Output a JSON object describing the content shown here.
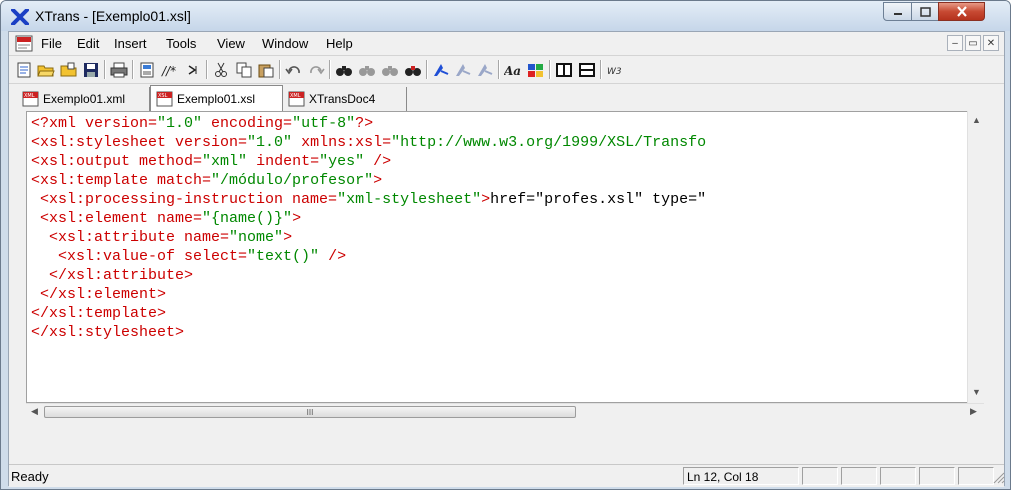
{
  "window": {
    "title": "XTrans - [Exemplo01.xsl]"
  },
  "menu": {
    "items": [
      "File",
      "Edit",
      "Insert",
      "Tools",
      "View",
      "Window",
      "Help"
    ]
  },
  "toolbar": {
    "buttons": [
      "new-icon",
      "open-icon",
      "open-folder-icon",
      "save-icon",
      "print-icon",
      "properties-icon",
      "comment-icon",
      "indent-icon",
      "cut-icon",
      "copy-icon",
      "paste-icon",
      "undo-icon",
      "redo-icon",
      "find-icon",
      "find-next-icon",
      "find-prev-icon",
      "replace-icon",
      "transform-icon",
      "transform-all-icon",
      "transform-options-icon",
      "font-icon",
      "color-icon",
      "split-vertical-icon",
      "split-horizontal-icon",
      "w3-icon"
    ],
    "w3_label": "W3"
  },
  "tabs": [
    {
      "label": "Exemplo01.xml",
      "icon": "xml-file-icon",
      "icon_text": "XML",
      "active": false
    },
    {
      "label": "Exemplo01.xsl",
      "icon": "xsl-file-icon",
      "icon_text": "XSL",
      "active": true
    },
    {
      "label": "XTransDoc4",
      "icon": "xml-file-icon",
      "icon_text": "XML",
      "active": false
    }
  ],
  "editor": {
    "lines": [
      [
        [
          "tag",
          "<?xml "
        ],
        [
          "attr",
          "version="
        ],
        [
          "val",
          "\"1.0\""
        ],
        [
          "attr",
          " encoding="
        ],
        [
          "val",
          "\"utf-8\""
        ],
        [
          "tag",
          "?>"
        ]
      ],
      [
        [
          "tag",
          "<xsl:stylesheet "
        ],
        [
          "attr",
          "version="
        ],
        [
          "val",
          "\"1.0\""
        ],
        [
          "attr",
          " xmlns:xsl="
        ],
        [
          "val",
          "\"http://www.w3.org/1999/XSL/Transfo"
        ]
      ],
      [
        [
          "tag",
          "<xsl:output "
        ],
        [
          "attr",
          "method="
        ],
        [
          "val",
          "\"xml\""
        ],
        [
          "attr",
          " indent="
        ],
        [
          "val",
          "\"yes\""
        ],
        [
          "tag",
          " />"
        ]
      ],
      [
        [
          "tag",
          "<xsl:template "
        ],
        [
          "attr",
          "match="
        ],
        [
          "val",
          "\"/módulo/profesor\""
        ],
        [
          "tag",
          ">"
        ]
      ],
      [
        [
          "tag",
          " <xsl:processing-instruction "
        ],
        [
          "attr",
          "name="
        ],
        [
          "val",
          "\"xml-stylesheet\""
        ],
        [
          "tag",
          ">"
        ],
        [
          "text",
          "href=\"profes.xsl\" type=\""
        ]
      ],
      [
        [
          "tag",
          " <xsl:element "
        ],
        [
          "attr",
          "name="
        ],
        [
          "val",
          "\"{name()}\""
        ],
        [
          "tag",
          ">"
        ]
      ],
      [
        [
          "tag",
          "  <xsl:attribute "
        ],
        [
          "attr",
          "name="
        ],
        [
          "val",
          "\"nome\""
        ],
        [
          "tag",
          ">"
        ]
      ],
      [
        [
          "tag",
          "   <xsl:value-of "
        ],
        [
          "attr",
          "select="
        ],
        [
          "val",
          "\"text()\""
        ],
        [
          "tag",
          " />"
        ]
      ],
      [
        [
          "tag",
          "  </xsl:attribute>"
        ]
      ],
      [
        [
          "tag",
          " </xsl:element>"
        ]
      ],
      [
        [
          "tag",
          "</xsl:template>"
        ]
      ],
      [
        [
          "tag",
          "</xsl:stylesheet>"
        ]
      ]
    ]
  },
  "hscroll": {
    "thumb_glyph": "III"
  },
  "status": {
    "text": "Ready",
    "position": "Ln 12, Col 18"
  },
  "colors": {
    "tag": "#cc0000",
    "value": "#008800",
    "close_button": "#c74a33"
  }
}
